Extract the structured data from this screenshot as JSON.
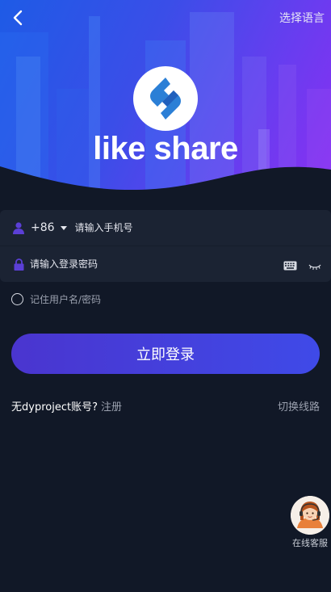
{
  "header": {
    "language_label": "选择语言"
  },
  "brand": {
    "name": "like share"
  },
  "login_form": {
    "country_code": "+86",
    "phone_placeholder": "请输入手机号",
    "password_placeholder": "请输入登录密码",
    "remember_label": "记住用户名/密码",
    "submit_label": "立即登录"
  },
  "footer_links": {
    "no_account_text": "无dyproject账号?",
    "register_label": "注册",
    "switch_line_label": "切换线路"
  },
  "support": {
    "label": "在线客服"
  },
  "colors": {
    "page_background": "#111827",
    "field_background": "#1b2333",
    "primary_button": "#4a35cf",
    "accent_purple": "#5b3fd6",
    "muted_text": "#9aa0ae"
  }
}
